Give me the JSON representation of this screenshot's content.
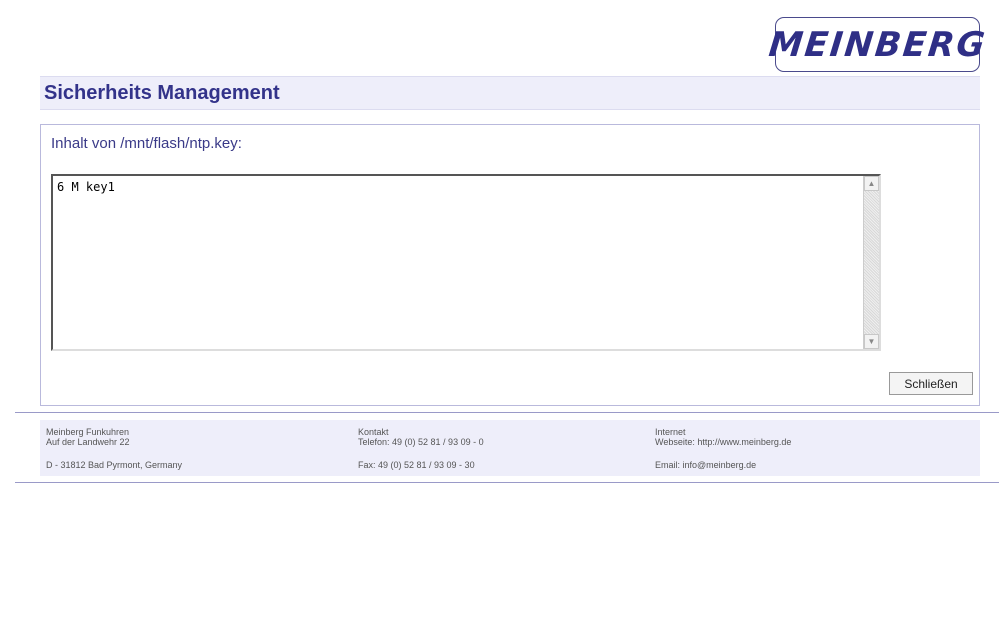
{
  "logo": {
    "text": "MEINBERG"
  },
  "header": {
    "title": "Sicherheits Management"
  },
  "panel": {
    "heading": "Inhalt von /mnt/flash/ntp.key:",
    "file_content": "6 M key1",
    "close_label": "Schließen"
  },
  "footer": {
    "company": {
      "name": "Meinberg Funkuhren",
      "street": "Auf der Landwehr 22",
      "city": "D - 31812 Bad Pyrmont, Germany"
    },
    "contact": {
      "label": "Kontakt",
      "phone": "Telefon: 49 (0) 52 81 / 93 09 - 0",
      "fax": "Fax: 49 (0) 52 81 / 93 09 - 30"
    },
    "internet": {
      "label": "Internet",
      "website": "Webseite: http://www.meinberg.de",
      "email": "Email: info@meinberg.de"
    }
  }
}
